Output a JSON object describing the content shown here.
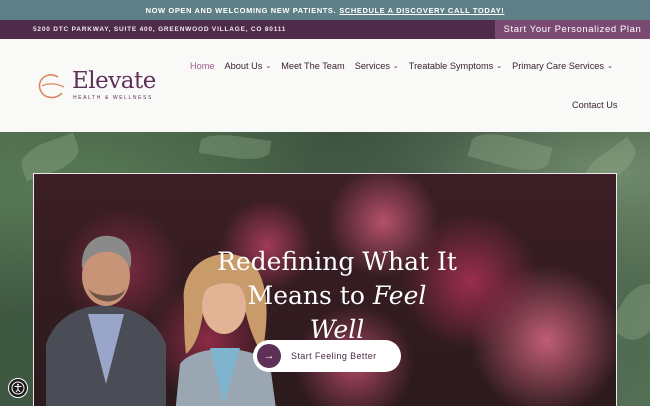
{
  "announcement": {
    "text": "NOW OPEN AND WELCOMING NEW PATIENTS.",
    "link": "SCHEDULE A DISCOVERY CALL TODAY!"
  },
  "infobar": {
    "address": "5200 DTC PARKWAY, SUITE 400, GREENWOOD VILLAGE, CO 80111",
    "plan_button": "Start Your Personalized Plan"
  },
  "logo": {
    "word": "Elevate",
    "sub": "HEALTH & WELLNESS"
  },
  "nav": {
    "items": [
      {
        "label": "Home",
        "active": true,
        "has_dropdown": false
      },
      {
        "label": "About Us",
        "active": false,
        "has_dropdown": true
      },
      {
        "label": "Meet The Team",
        "active": false,
        "has_dropdown": false
      },
      {
        "label": "Services",
        "active": false,
        "has_dropdown": true
      },
      {
        "label": "Treatable Symptoms",
        "active": false,
        "has_dropdown": true
      },
      {
        "label": "Primary Care Services",
        "active": false,
        "has_dropdown": true
      }
    ],
    "contact": "Contact Us",
    "chevron": "⌄"
  },
  "hero": {
    "headline_line1": "Redefining What It",
    "headline_line2_plain": "Means to ",
    "headline_line2_italic": "Feel Well",
    "cta_label": "Start Feeling Better",
    "cta_arrow": "→"
  },
  "colors": {
    "brand_plum": "#5e2f57",
    "announce_bg": "#5f7f86",
    "infobar_bg": "#4f2b4b",
    "plan_button_bg": "#7a4a72"
  },
  "icons": {
    "cta": "arrow-right-icon",
    "accessibility": "accessibility-icon",
    "dropdown": "chevron-down-icon"
  }
}
